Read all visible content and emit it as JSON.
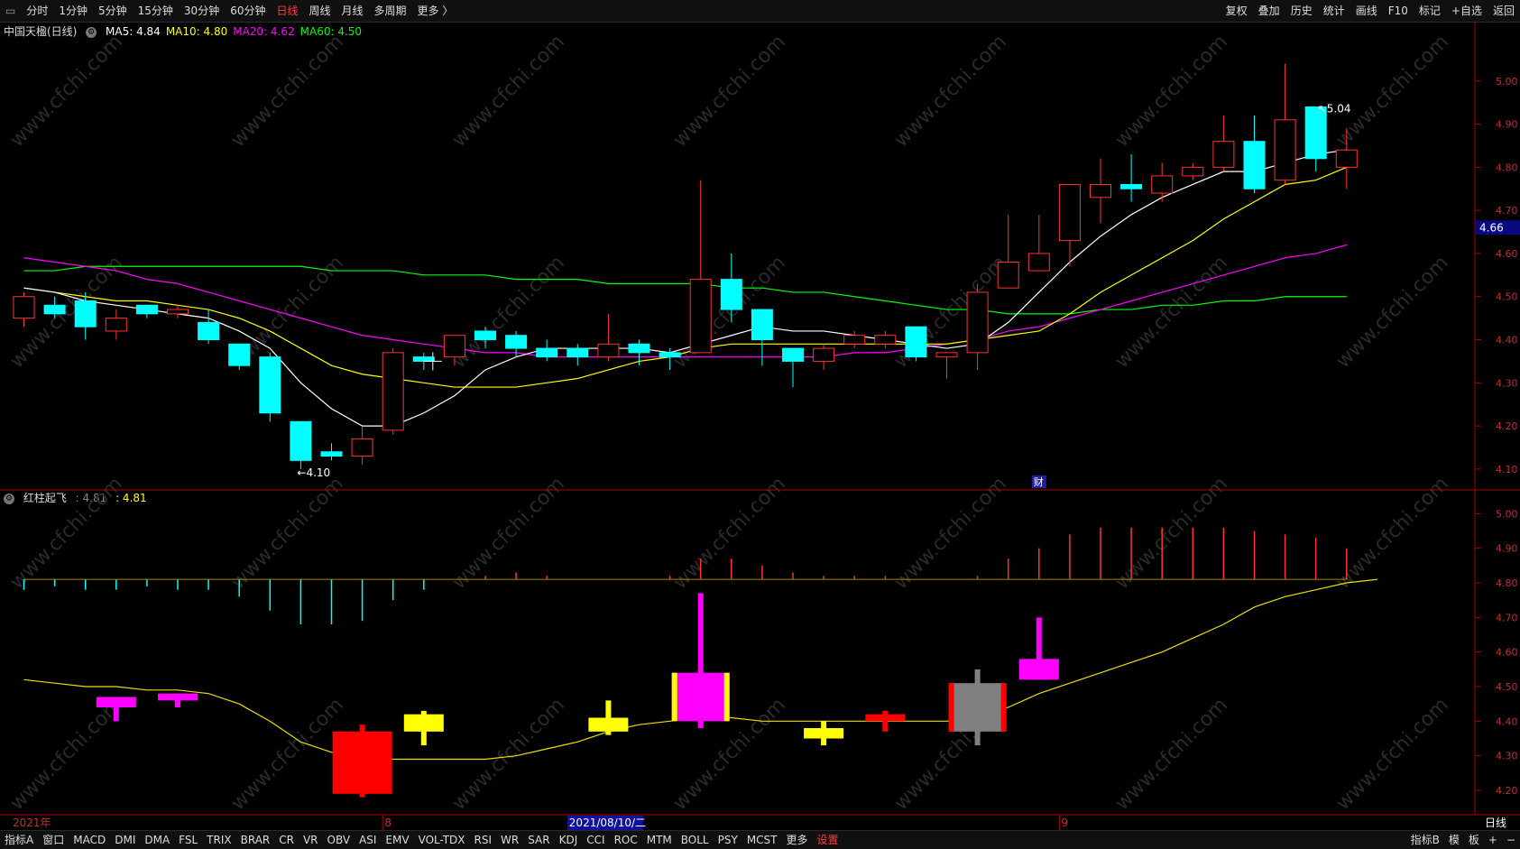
{
  "toolbar": {
    "left_icon": "window-restore-icon",
    "periods": [
      "分时",
      "1分钟",
      "5分钟",
      "15分钟",
      "30分钟",
      "60分钟",
      "日线",
      "周线",
      "月线",
      "多周期",
      "更多 〉"
    ],
    "active_index": 6,
    "right_items": [
      "复权",
      "叠加",
      "历史",
      "统计",
      "画线",
      "F10",
      "标记",
      "+自选",
      "返回"
    ]
  },
  "main_chart": {
    "stock_name": "中国天楹(日线)",
    "ma_labels": [
      {
        "text": "MA5: 4.84",
        "color": "#ffffff"
      },
      {
        "text": "MA10: 4.80",
        "color": "#ffff00"
      },
      {
        "text": "MA20: 4.62",
        "color": "#ff00ff"
      },
      {
        "text": "MA60: 4.50",
        "color": "#00ff00"
      }
    ],
    "y_ticks": [
      "5.00",
      "4.90",
      "4.80",
      "4.70",
      "4.60",
      "4.50",
      "4.40",
      "4.30",
      "4.20",
      "4.10"
    ],
    "ylim": [
      4.06,
      5.1
    ],
    "current_price": "4.66",
    "high_label": "5.04",
    "low_label": "4.10",
    "low_index": 9,
    "high_index": 42,
    "finance_mark": "财",
    "finance_mark_index": 33,
    "candles": [
      [
        4.45,
        4.5,
        4.51,
        4.43
      ],
      [
        4.48,
        4.46,
        4.5,
        4.45
      ],
      [
        4.49,
        4.43,
        4.51,
        4.4
      ],
      [
        4.42,
        4.45,
        4.47,
        4.4
      ],
      [
        4.48,
        4.46,
        4.48,
        4.45
      ],
      [
        4.46,
        4.47,
        4.48,
        4.45
      ],
      [
        4.44,
        4.4,
        4.47,
        4.39
      ],
      [
        4.39,
        4.34,
        4.39,
        4.33
      ],
      [
        4.36,
        4.23,
        4.37,
        4.21
      ],
      [
        4.21,
        4.12,
        4.21,
        4.1
      ],
      [
        4.14,
        4.13,
        4.16,
        4.12
      ],
      [
        4.13,
        4.17,
        4.2,
        4.11
      ],
      [
        4.19,
        4.37,
        4.38,
        4.18
      ],
      [
        4.36,
        4.35,
        4.37,
        4.33
      ],
      [
        4.36,
        4.41,
        4.41,
        4.34
      ],
      [
        4.42,
        4.4,
        4.43,
        4.38
      ],
      [
        4.41,
        4.38,
        4.42,
        4.36
      ],
      [
        4.38,
        4.36,
        4.4,
        4.35
      ],
      [
        4.38,
        4.36,
        4.39,
        4.34
      ],
      [
        4.36,
        4.39,
        4.46,
        4.35
      ],
      [
        4.39,
        4.37,
        4.4,
        4.34
      ],
      [
        4.37,
        4.36,
        4.38,
        4.33
      ],
      [
        4.37,
        4.54,
        4.77,
        4.37
      ],
      [
        4.54,
        4.47,
        4.6,
        4.44
      ],
      [
        4.47,
        4.4,
        4.47,
        4.34
      ],
      [
        4.38,
        4.35,
        4.38,
        4.29
      ],
      [
        4.35,
        4.38,
        4.39,
        4.33
      ],
      [
        4.39,
        4.41,
        4.42,
        4.38
      ],
      [
        4.39,
        4.41,
        4.42,
        4.38
      ],
      [
        4.43,
        4.36,
        4.43,
        4.35
      ],
      [
        4.36,
        4.37,
        4.37,
        4.31
      ],
      [
        4.37,
        4.51,
        4.53,
        4.33
      ],
      [
        4.52,
        4.58,
        4.69,
        4.52
      ],
      [
        4.56,
        4.6,
        4.69,
        4.56
      ],
      [
        4.63,
        4.76,
        4.76,
        4.57
      ],
      [
        4.73,
        4.76,
        4.82,
        4.67
      ],
      [
        4.76,
        4.75,
        4.83,
        4.72
      ],
      [
        4.74,
        4.78,
        4.81,
        4.72
      ],
      [
        4.78,
        4.8,
        4.81,
        4.77
      ],
      [
        4.8,
        4.86,
        4.92,
        4.79
      ],
      [
        4.86,
        4.75,
        4.92,
        4.74
      ],
      [
        4.77,
        4.91,
        5.04,
        4.76
      ],
      [
        4.94,
        4.82,
        4.94,
        4.79
      ],
      [
        4.8,
        4.84,
        4.89,
        4.75
      ]
    ],
    "ma5": [
      4.52,
      4.51,
      4.49,
      4.48,
      4.47,
      4.46,
      4.45,
      4.42,
      4.38,
      4.3,
      4.24,
      4.2,
      4.2,
      4.23,
      4.27,
      4.33,
      4.36,
      4.38,
      4.38,
      4.38,
      4.38,
      4.37,
      4.39,
      4.41,
      4.43,
      4.42,
      4.42,
      4.41,
      4.4,
      4.39,
      4.38,
      4.39,
      4.44,
      4.51,
      4.58,
      4.64,
      4.69,
      4.73,
      4.76,
      4.79,
      4.79,
      4.81,
      4.83,
      4.84
    ],
    "ma10": [
      4.52,
      4.51,
      4.5,
      4.49,
      4.49,
      4.48,
      4.47,
      4.45,
      4.42,
      4.38,
      4.34,
      4.32,
      4.31,
      4.3,
      4.29,
      4.29,
      4.29,
      4.3,
      4.31,
      4.33,
      4.35,
      4.36,
      4.38,
      4.39,
      4.39,
      4.39,
      4.39,
      4.39,
      4.39,
      4.39,
      4.39,
      4.4,
      4.41,
      4.42,
      4.46,
      4.51,
      4.55,
      4.59,
      4.63,
      4.68,
      4.72,
      4.76,
      4.77,
      4.8
    ],
    "ma20": [
      4.59,
      4.58,
      4.57,
      4.56,
      4.54,
      4.53,
      4.51,
      4.49,
      4.47,
      4.45,
      4.43,
      4.41,
      4.4,
      4.39,
      4.38,
      4.37,
      4.37,
      4.36,
      4.36,
      4.36,
      4.36,
      4.36,
      4.36,
      4.36,
      4.36,
      4.36,
      4.36,
      4.37,
      4.37,
      4.38,
      4.39,
      4.4,
      4.42,
      4.43,
      4.45,
      4.47,
      4.49,
      4.51,
      4.53,
      4.55,
      4.57,
      4.59,
      4.6,
      4.62
    ],
    "ma60": [
      4.56,
      4.56,
      4.57,
      4.57,
      4.57,
      4.57,
      4.57,
      4.57,
      4.57,
      4.57,
      4.56,
      4.56,
      4.56,
      4.55,
      4.55,
      4.55,
      4.54,
      4.54,
      4.54,
      4.53,
      4.53,
      4.53,
      4.53,
      4.52,
      4.52,
      4.51,
      4.51,
      4.5,
      4.49,
      4.48,
      4.47,
      4.47,
      4.46,
      4.46,
      4.46,
      4.47,
      4.47,
      4.48,
      4.48,
      4.49,
      4.49,
      4.5,
      4.5,
      4.5
    ]
  },
  "indicator_chart": {
    "name": "红柱起飞",
    "value1": ": 4.81",
    "value2": ": 4.81",
    "y_ticks": [
      "5.00",
      "4.90",
      "4.80",
      "4.70",
      "4.60",
      "4.50",
      "4.40",
      "4.30",
      "4.20"
    ],
    "ylim": [
      4.14,
      5.04
    ],
    "baseline": 4.81,
    "bars": [
      -0.03,
      -0.02,
      -0.03,
      -0.03,
      -0.02,
      -0.03,
      -0.03,
      -0.05,
      -0.09,
      -0.13,
      -0.13,
      -0.12,
      -0.06,
      -0.03,
      0,
      0.01,
      0.02,
      0.01,
      0,
      0,
      0,
      0.01,
      0.06,
      0.06,
      0.04,
      0.02,
      0.01,
      0.01,
      0.01,
      0,
      0,
      0.01,
      0.06,
      0.09,
      0.13,
      0.15,
      0.15,
      0.15,
      0.15,
      0.15,
      0.14,
      0.13,
      0.12,
      0.09
    ],
    "line": [
      4.52,
      4.51,
      4.5,
      4.5,
      4.49,
      4.49,
      4.48,
      4.45,
      4.4,
      4.34,
      4.31,
      4.3,
      4.29,
      4.29,
      4.29,
      4.29,
      4.3,
      4.32,
      4.34,
      4.37,
      4.39,
      4.4,
      4.41,
      4.41,
      4.4,
      4.4,
      4.4,
      4.4,
      4.4,
      4.4,
      4.4,
      4.41,
      4.44,
      4.48,
      4.51,
      4.54,
      4.57,
      4.6,
      4.64,
      4.68,
      4.73,
      4.76,
      4.78,
      4.8,
      4.81
    ],
    "signals": [
      {
        "i": 3,
        "top": 4.47,
        "bot": 4.44,
        "hi": 4.47,
        "lo": 4.4,
        "color": "#ff00ff"
      },
      {
        "i": 5,
        "top": 4.48,
        "bot": 4.46,
        "hi": 4.48,
        "lo": 4.44,
        "color": "#ff00ff"
      },
      {
        "i": 11,
        "top": 4.37,
        "bot": 4.19,
        "hi": 4.39,
        "lo": 4.18,
        "color": "#ff0000"
      },
      {
        "i": 13,
        "top": 4.42,
        "bot": 4.37,
        "hi": 4.43,
        "lo": 4.33,
        "color": "#ffff00"
      },
      {
        "i": 19,
        "top": 4.41,
        "bot": 4.37,
        "hi": 4.46,
        "lo": 4.36,
        "color": "#ffff00"
      },
      {
        "i": 22,
        "top": 4.54,
        "bot": 4.4,
        "hi": 4.77,
        "lo": 4.38,
        "color": "#ff00ff",
        "edge": "#ffff00",
        "wide": true
      },
      {
        "i": 26,
        "top": 4.38,
        "bot": 4.35,
        "hi": 4.4,
        "lo": 4.33,
        "color": "#ffff00"
      },
      {
        "i": 28,
        "top": 4.42,
        "bot": 4.4,
        "hi": 4.43,
        "lo": 4.37,
        "color": "#ff0000"
      },
      {
        "i": 31,
        "top": 4.51,
        "bot": 4.37,
        "hi": 4.55,
        "lo": 4.33,
        "color": "#808080",
        "edge": "#ff0000",
        "wide": true
      },
      {
        "i": 33,
        "top": 4.58,
        "bot": 4.52,
        "hi": 4.7,
        "lo": 4.52,
        "color": "#ff00ff"
      }
    ]
  },
  "date_axis": {
    "year_label": "2021年",
    "month_mark_1": "8",
    "month_mark_1_index": 12,
    "cursor_date": "2021/08/10/二",
    "cursor_index": 18,
    "month_mark_2": "9",
    "month_mark_2_index": 34,
    "period_label": "日线"
  },
  "bottom_tabs": {
    "items": [
      "指标A",
      "窗口",
      "MACD",
      "DMI",
      "DMA",
      "FSL",
      "TRIX",
      "BRAR",
      "CR",
      "VR",
      "OBV",
      "ASI",
      "EMV",
      "VOL-TDX",
      "RSI",
      "WR",
      "SAR",
      "KDJ",
      "CCI",
      "ROC",
      "MTM",
      "BOLL",
      "PSY",
      "MCST",
      "更多",
      "设置"
    ],
    "active_index": 25,
    "right_items": [
      "指标B",
      "模",
      "板",
      "+",
      "−"
    ]
  },
  "watermark": "www.cfchi.com",
  "colors": {
    "up": "#ff3232",
    "down": "#00ffff",
    "ma5": "#ffffff",
    "ma10": "#ffff00",
    "ma20": "#ff00ff",
    "ma60": "#00ff00",
    "axis": "#b00000"
  }
}
